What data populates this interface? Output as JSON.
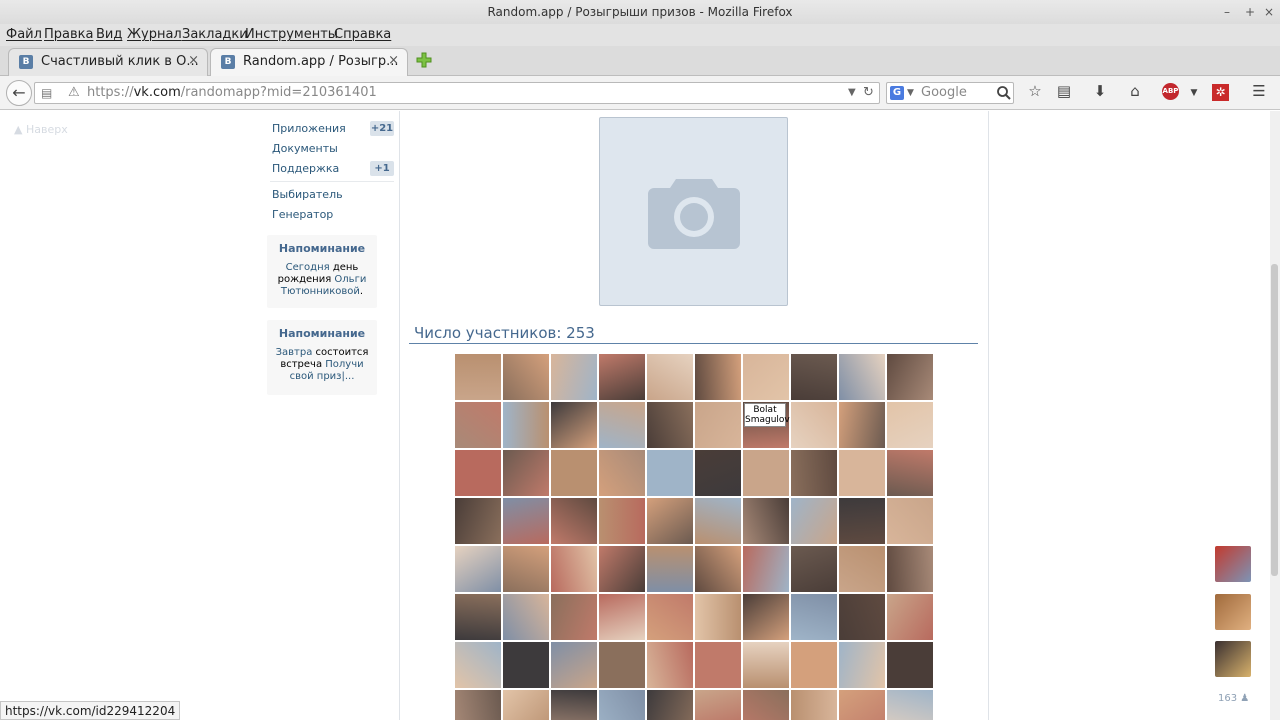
{
  "window": {
    "title": "Random.app / Розыгрыши призов - Mozilla Firefox",
    "minimize": "–",
    "maximize": "+",
    "close": "×"
  },
  "menu": [
    "Файл",
    "Правка",
    "Вид",
    "Журнал",
    "Закладки",
    "Инструменты",
    "Справка"
  ],
  "tabs": [
    {
      "favicon": "В",
      "title": "Счастливый клик в О...",
      "close": "×"
    },
    {
      "favicon": "В",
      "title": "Random.app / Розыгр...",
      "close": "×"
    }
  ],
  "address": {
    "prefix": "https://",
    "host": "vk.com",
    "path": "/randomapp?mid=210361401"
  },
  "search": {
    "engine": "G",
    "placeholder": "Google"
  },
  "sidebar": {
    "back_to_top": "Наверх",
    "items": [
      {
        "label": "Приложения",
        "count": "+21"
      },
      {
        "label": "Документы",
        "count": ""
      },
      {
        "label": "Поддержка",
        "count": "+1"
      },
      {
        "label": "Выбиратель",
        "count": ""
      },
      {
        "label": "Генератор",
        "count": ""
      }
    ]
  },
  "reminders": [
    {
      "heading": "Напоминание",
      "link1": "Сегодня",
      "text1": " день рождения ",
      "link2": "Ольги Тютюнниковой",
      "text2": "."
    },
    {
      "heading": "Напоминание",
      "link1": "Завтра",
      "text1": " состоится встреча ",
      "link2": "Получи свой приз|...",
      "text2": ""
    }
  ],
  "main": {
    "participants_label": "Число участников: 253"
  },
  "tooltip": {
    "line1": "Bolat",
    "line2": "Smagulov"
  },
  "status": {
    "url": "https://vk.com/id229412204"
  },
  "online": {
    "count": "163"
  },
  "colors": {
    "vk_link": "#2b587a",
    "vk_heading": "#45688e",
    "vk_accent": "#5e82a8"
  },
  "icons": [
    "back-arrow-icon",
    "identity-icon",
    "warning-icon",
    "dropdown-icon",
    "reload-icon",
    "search-icon",
    "star-icon",
    "reading-list-icon",
    "download-icon",
    "home-icon",
    "adblock-icon",
    "addon-icon",
    "hamburger-menu-icon",
    "camera-icon",
    "user-icon"
  ]
}
